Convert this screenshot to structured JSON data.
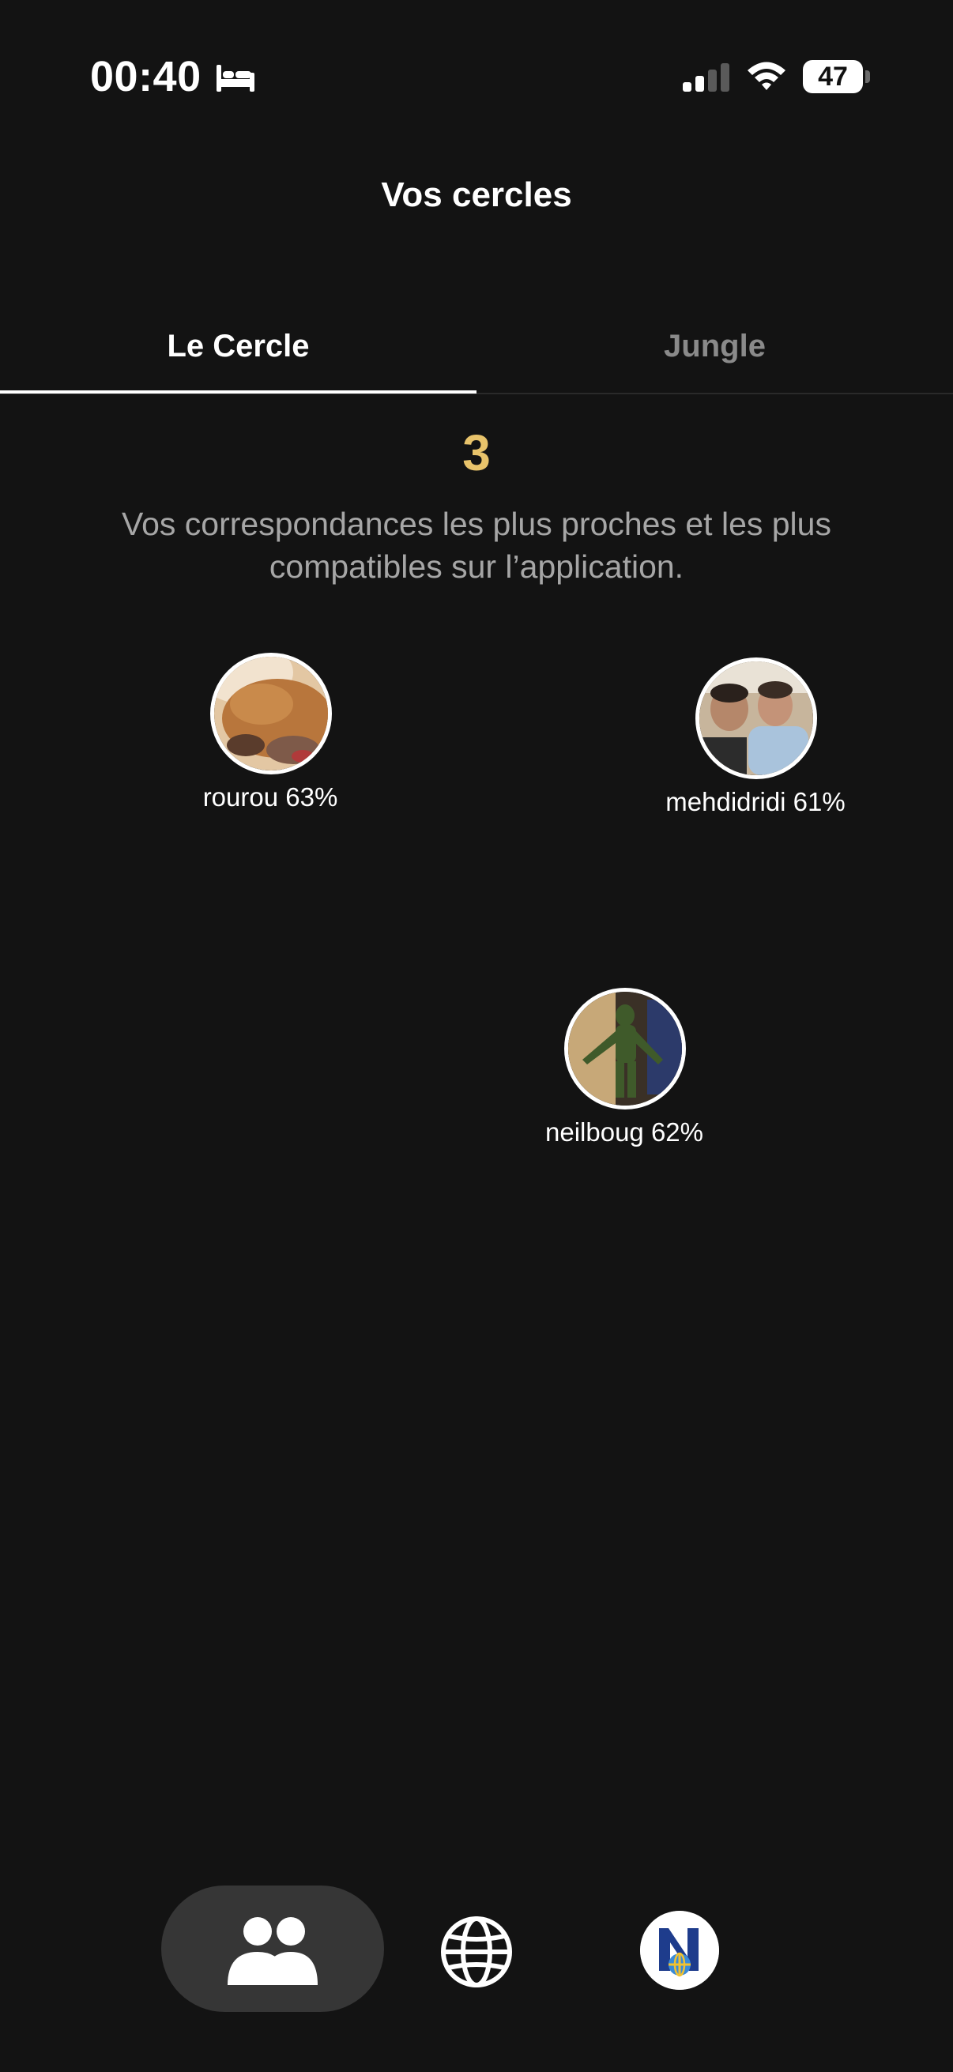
{
  "status_bar": {
    "time": "00:40",
    "battery": "47"
  },
  "header": {
    "title": "Vos cercles"
  },
  "tabs": [
    {
      "label": "Le Cercle",
      "active": true
    },
    {
      "label": "Jungle",
      "active": false
    }
  ],
  "circle": {
    "count": "3",
    "description": "Vos correspondances les plus proches et les plus compatibles sur l’application.",
    "profiles": [
      {
        "label": "rourou 63%",
        "username": "rourou",
        "compatibility": 63
      },
      {
        "label": "mehdidridi 61%",
        "username": "mehdidridi",
        "compatibility": 61
      },
      {
        "label": "neilboug 62%",
        "username": "neilboug",
        "compatibility": 62
      }
    ]
  },
  "bottom_nav": {
    "items": [
      {
        "icon": "people-icon",
        "active": true
      },
      {
        "icon": "globe-icon",
        "active": false
      },
      {
        "icon": "news-app-icon",
        "active": false
      }
    ]
  },
  "colors": {
    "background": "#131313",
    "accent_count": "#e8c36b",
    "tab_inactive": "#8a8a8a",
    "description": "#a6a6a6",
    "nav_pill": "#363636"
  }
}
